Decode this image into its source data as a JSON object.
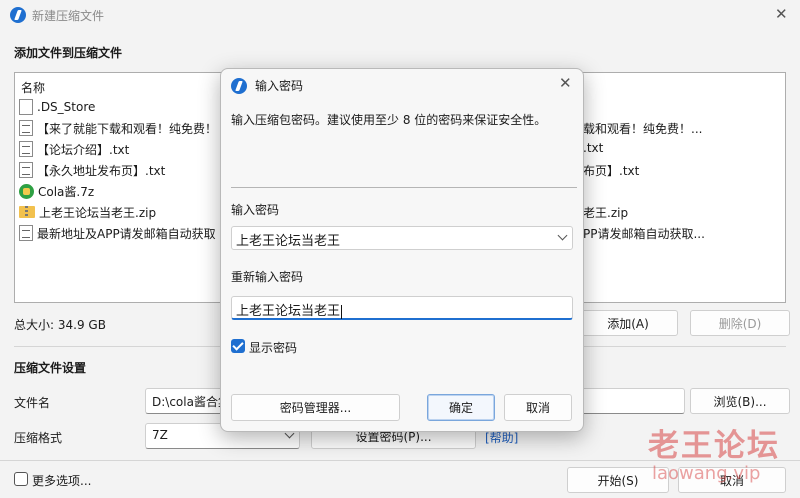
{
  "main_window": {
    "title": "新建压缩文件",
    "files_section_title": "添加文件到压缩文件",
    "column_name": "名称",
    "files": [
      {
        "name": ".DS_Store",
        "icon": "blank-file-icon",
        "right_part": ""
      },
      {
        "name": "【来了就能下载和观看！纯免费！",
        "icon": "text-file-icon",
        "right_part": "载和观看！纯免费！..."
      },
      {
        "name": "【论坛介绍】.txt",
        "icon": "text-file-icon",
        "right_part": ".txt"
      },
      {
        "name": "【永久地址发布页】.txt",
        "icon": "text-file-icon",
        "right_part": "布页】.txt"
      },
      {
        "name": "Cola酱.7z",
        "icon": "7z-archive-icon",
        "right_part": ""
      },
      {
        "name": "上老王论坛当老王.zip",
        "icon": "zip-archive-icon",
        "right_part": "老王.zip"
      },
      {
        "name": "最新地址及APP请发邮箱自动获取",
        "icon": "text-file-icon",
        "right_part": "PP请发邮箱自动获取..."
      }
    ],
    "total_size": "总大小: 34.9 GB",
    "add_button": "添加(A)",
    "delete_button": "删除(D)",
    "archive_section_title": "压缩文件设置",
    "filename_label": "文件名",
    "filename_value": "D:\\cola酱合集",
    "browse_button": "浏览(B)...",
    "format_label": "压缩格式",
    "format_value": "7Z",
    "set_password_button": "设置密码(P)...",
    "help_link": "[帮助]",
    "more_options": "更多选项...",
    "start_button": "开始(S)",
    "cancel_button": "取消"
  },
  "dialog": {
    "title": "输入密码",
    "hint": "输入压缩包密码。建议使用至少 8 位的密码来保证安全性。",
    "password_label": "输入密码",
    "password_value": "上老王论坛当老王",
    "confirm_label": "重新输入密码",
    "confirm_value": "上老王论坛当老王",
    "show_password": "显示密码",
    "show_password_checked": true,
    "manager_button": "密码管理器...",
    "ok_button": "确定",
    "cancel_button": "取消"
  },
  "watermark": {
    "text": "老王论坛",
    "url": "laowang.vip"
  },
  "colors": {
    "accent": "#1f6fd0",
    "watermark": "#d74646",
    "link": "#1f5fbf"
  }
}
